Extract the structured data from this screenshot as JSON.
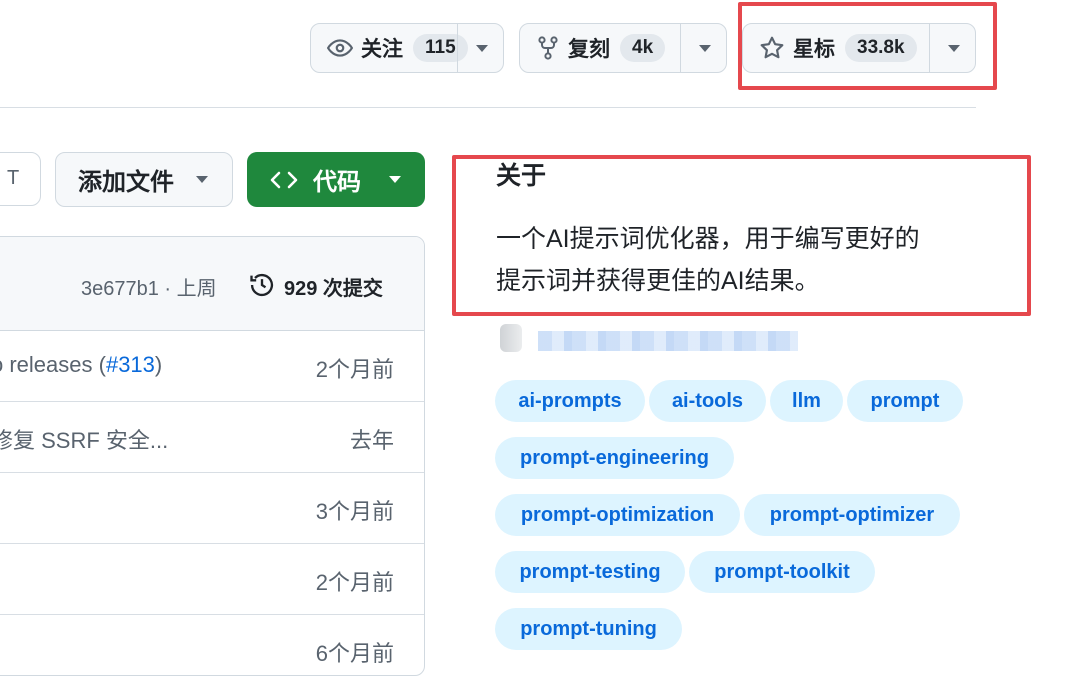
{
  "header_actions": {
    "watch": {
      "label": "关注",
      "count": "115",
      "icon": "eye-icon"
    },
    "fork": {
      "label": "复刻",
      "count": "4k",
      "icon": "repo-forked-icon"
    },
    "star": {
      "label": "星标",
      "count": "33.8k",
      "icon": "star-icon"
    }
  },
  "toolbar": {
    "partial_button_text": "T",
    "add_file_label": "添加文件",
    "code_label": "代码"
  },
  "commits": {
    "latest": "3e677b1 · 上周",
    "total": "929 次提交",
    "rows": [
      {
        "msg_prefix": "o releases (",
        "link": "#313",
        "msg_suffix": ")",
        "time": "2个月前"
      },
      {
        "msg": "修复 SSRF 安全...",
        "time": "去年"
      },
      {
        "msg": "",
        "time": "3个月前"
      },
      {
        "msg": "",
        "time": "2个月前"
      },
      {
        "msg": "",
        "time": "6个月前"
      }
    ]
  },
  "about": {
    "title": "关于",
    "description_line1": "一个AI提示词优化器，用于编写更好的",
    "description_line2": "提示词并获得更佳的AI结果。",
    "topics": [
      "ai-prompts",
      "ai-tools",
      "llm",
      "prompt",
      "prompt-engineering",
      "prompt-optimization",
      "prompt-optimizer",
      "prompt-testing",
      "prompt-toolkit",
      "prompt-tuning"
    ]
  },
  "colors": {
    "accent_green": "#1f883d",
    "link_blue": "#0969da",
    "highlight_red": "#e5484d",
    "topic_bg": "#ddf4ff"
  }
}
